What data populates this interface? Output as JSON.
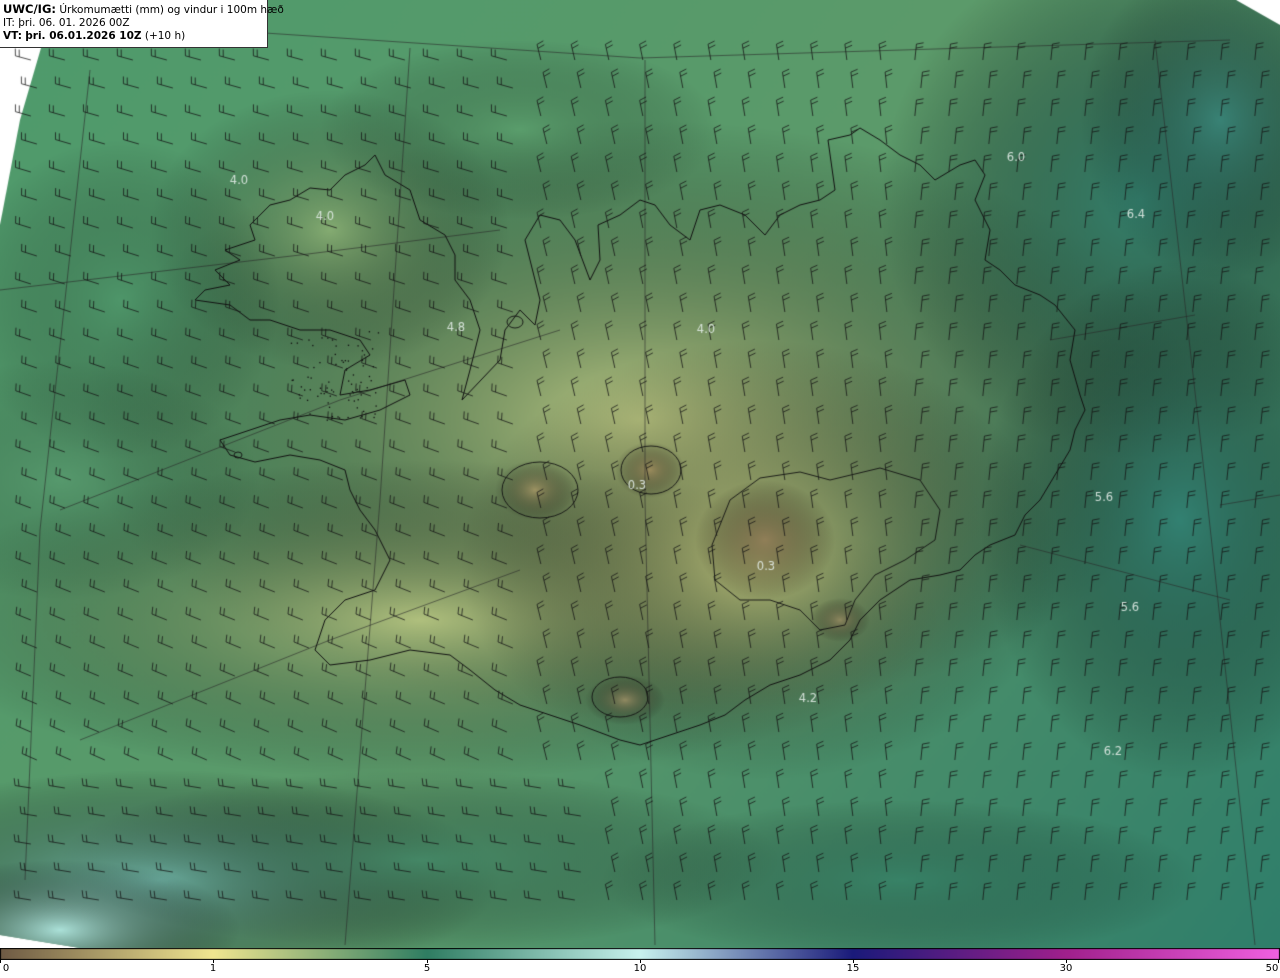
{
  "header": {
    "model": "UWC/IG:",
    "description": "Úrkomumætti (mm) og vindur i 100m hæð",
    "it_label": "IT:",
    "it_value": "þri. 06. 01. 2026 00Z",
    "vt_label": "VT:",
    "vt_value": "þri. 06.01.2026 10Z",
    "lead": "(+10 h)"
  },
  "map": {
    "region": "Iceland",
    "field": "precipitable water",
    "units": "mm",
    "wind_level": "100m",
    "value_labels": [
      {
        "text": "4.0",
        "place": "northwest sea"
      },
      {
        "text": "4.0",
        "place": "westfjords"
      },
      {
        "text": "4.8",
        "place": "northwest inland"
      },
      {
        "text": "4.0",
        "place": "north Iceland"
      },
      {
        "text": "6.0",
        "place": "northeast sea"
      },
      {
        "text": "6.4",
        "place": "northeast offshore"
      },
      {
        "text": "0.3",
        "place": "Hofsjökull"
      },
      {
        "text": "0.3",
        "place": "Vatnajökull"
      },
      {
        "text": "5.6",
        "place": "east coast sea"
      },
      {
        "text": "5.6",
        "place": "southeast sea"
      },
      {
        "text": "4.2",
        "place": "south coast sea"
      },
      {
        "text": "6.2",
        "place": "southeast offshore"
      }
    ],
    "colors": {
      "lowest": "#7a6448",
      "low": "#e8e08c",
      "mid": "#2e7e64",
      "high": "#a8e6e0",
      "coast": "#111111",
      "grid": "#3a3a3a",
      "barb": "#1a1a1a"
    }
  },
  "colorbar": {
    "ticks": [
      "0",
      "1",
      "5",
      "10",
      "15",
      "30",
      "50"
    ],
    "stops": [
      {
        "value": 0,
        "color": "#6e5a44"
      },
      {
        "value": 1,
        "color": "#f0e690"
      },
      {
        "value": 5,
        "color": "#2f7d62"
      },
      {
        "value": 10,
        "color": "#c8f2ee"
      },
      {
        "value": 15,
        "color": "#1a1a7a"
      },
      {
        "value": 30,
        "color": "#a0208c"
      },
      {
        "value": 50,
        "color": "#f060e0"
      }
    ]
  }
}
